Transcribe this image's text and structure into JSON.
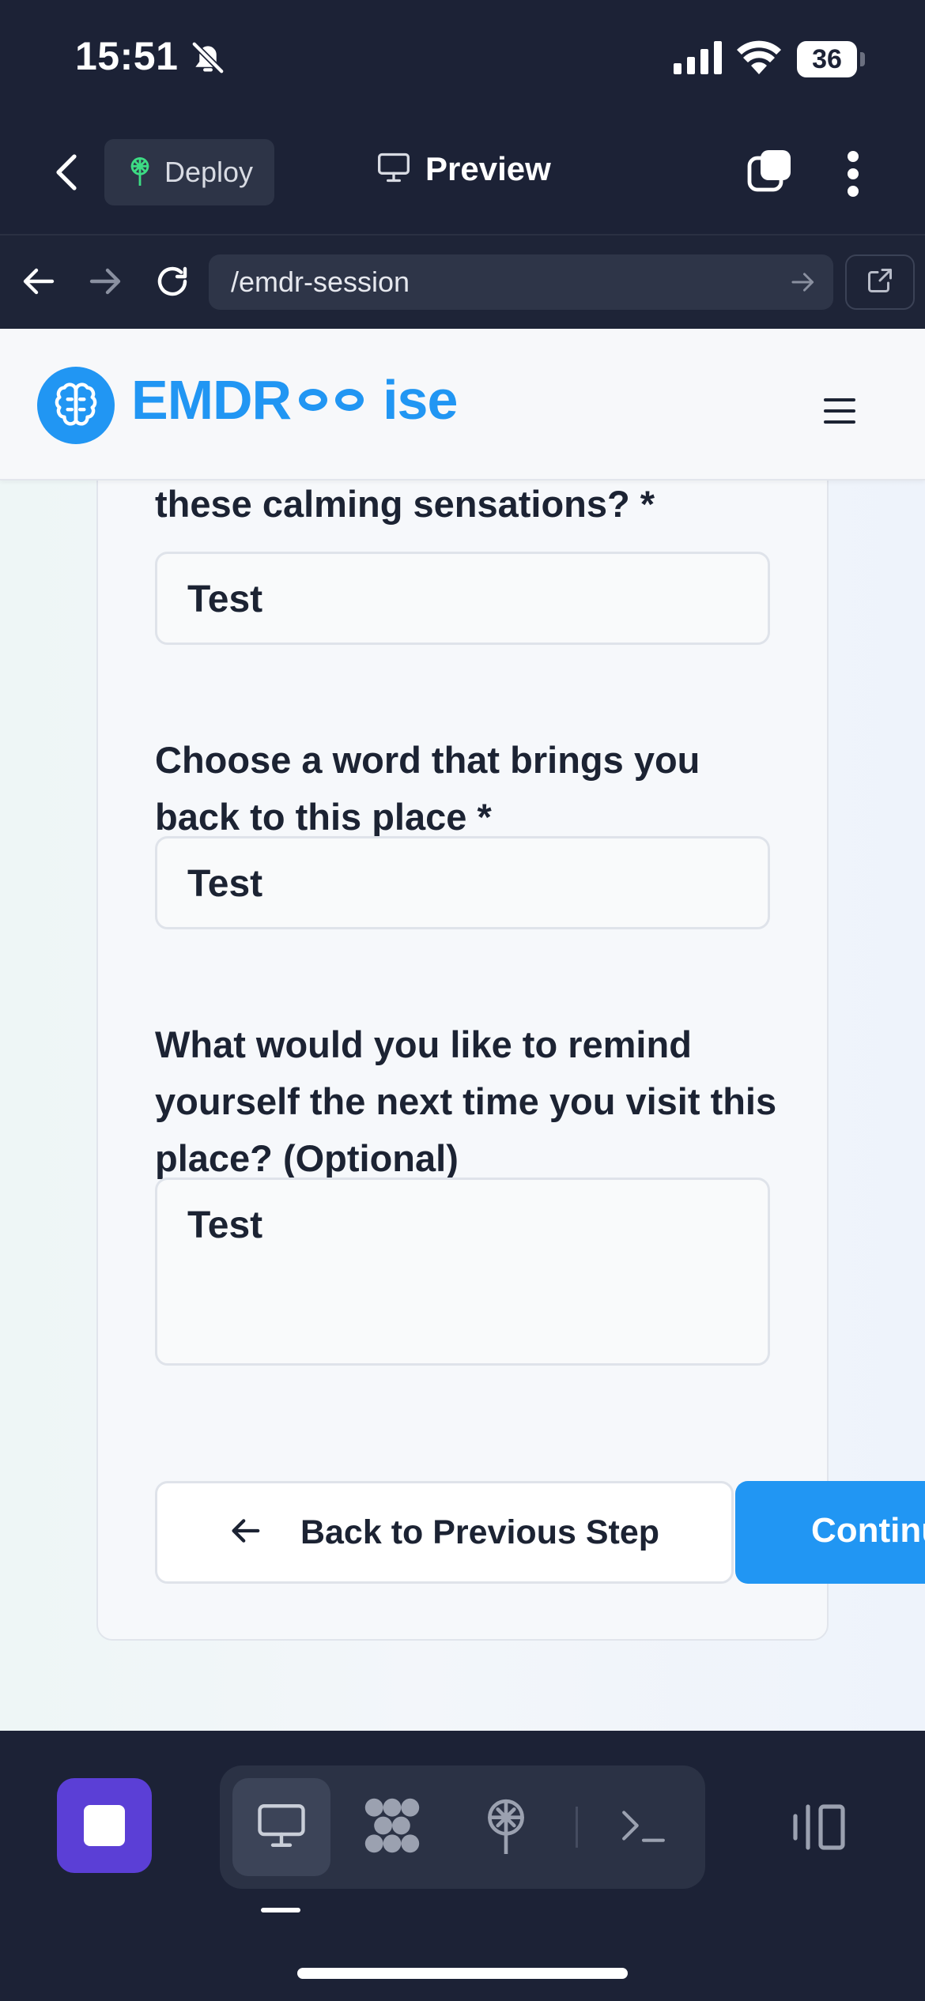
{
  "status_bar": {
    "time": "15:51",
    "battery": "36",
    "icons": [
      "bell-slash-icon",
      "signal-icon",
      "wifi-icon",
      "battery-icon"
    ]
  },
  "toolbar": {
    "deploy_label": "Deploy",
    "preview_label": "Preview",
    "icons": [
      "chevron-left-icon",
      "deploy-icon",
      "monitor-icon",
      "tabs-icon",
      "kebab-menu-icon"
    ]
  },
  "browser": {
    "url": "/emdr-session",
    "icons": [
      "arrow-left-icon",
      "arrow-right-icon",
      "reload-icon",
      "go-arrow-icon",
      "external-link-icon"
    ]
  },
  "site": {
    "logo_prefix": "EMDR",
    "logo_suffix": "ise",
    "brand_color": "#2196f3"
  },
  "form": {
    "q1_label": "these calming sensations? *",
    "q1_value": "Test",
    "q2_label": "Choose a word that brings you back to this place *",
    "q2_value": "Test",
    "q3_label": "What would you like to remind yourself the next time you visit this place? (Optional)",
    "q3_value": "Test",
    "back_button": "Back to Previous Step",
    "continue_button": "Continue"
  },
  "dock": {
    "accent": "#5b3fd6",
    "icons": [
      "stop-icon",
      "monitor-icon",
      "apps-icon",
      "deploy-icon",
      "terminal-icon",
      "sidebar-icon"
    ]
  }
}
